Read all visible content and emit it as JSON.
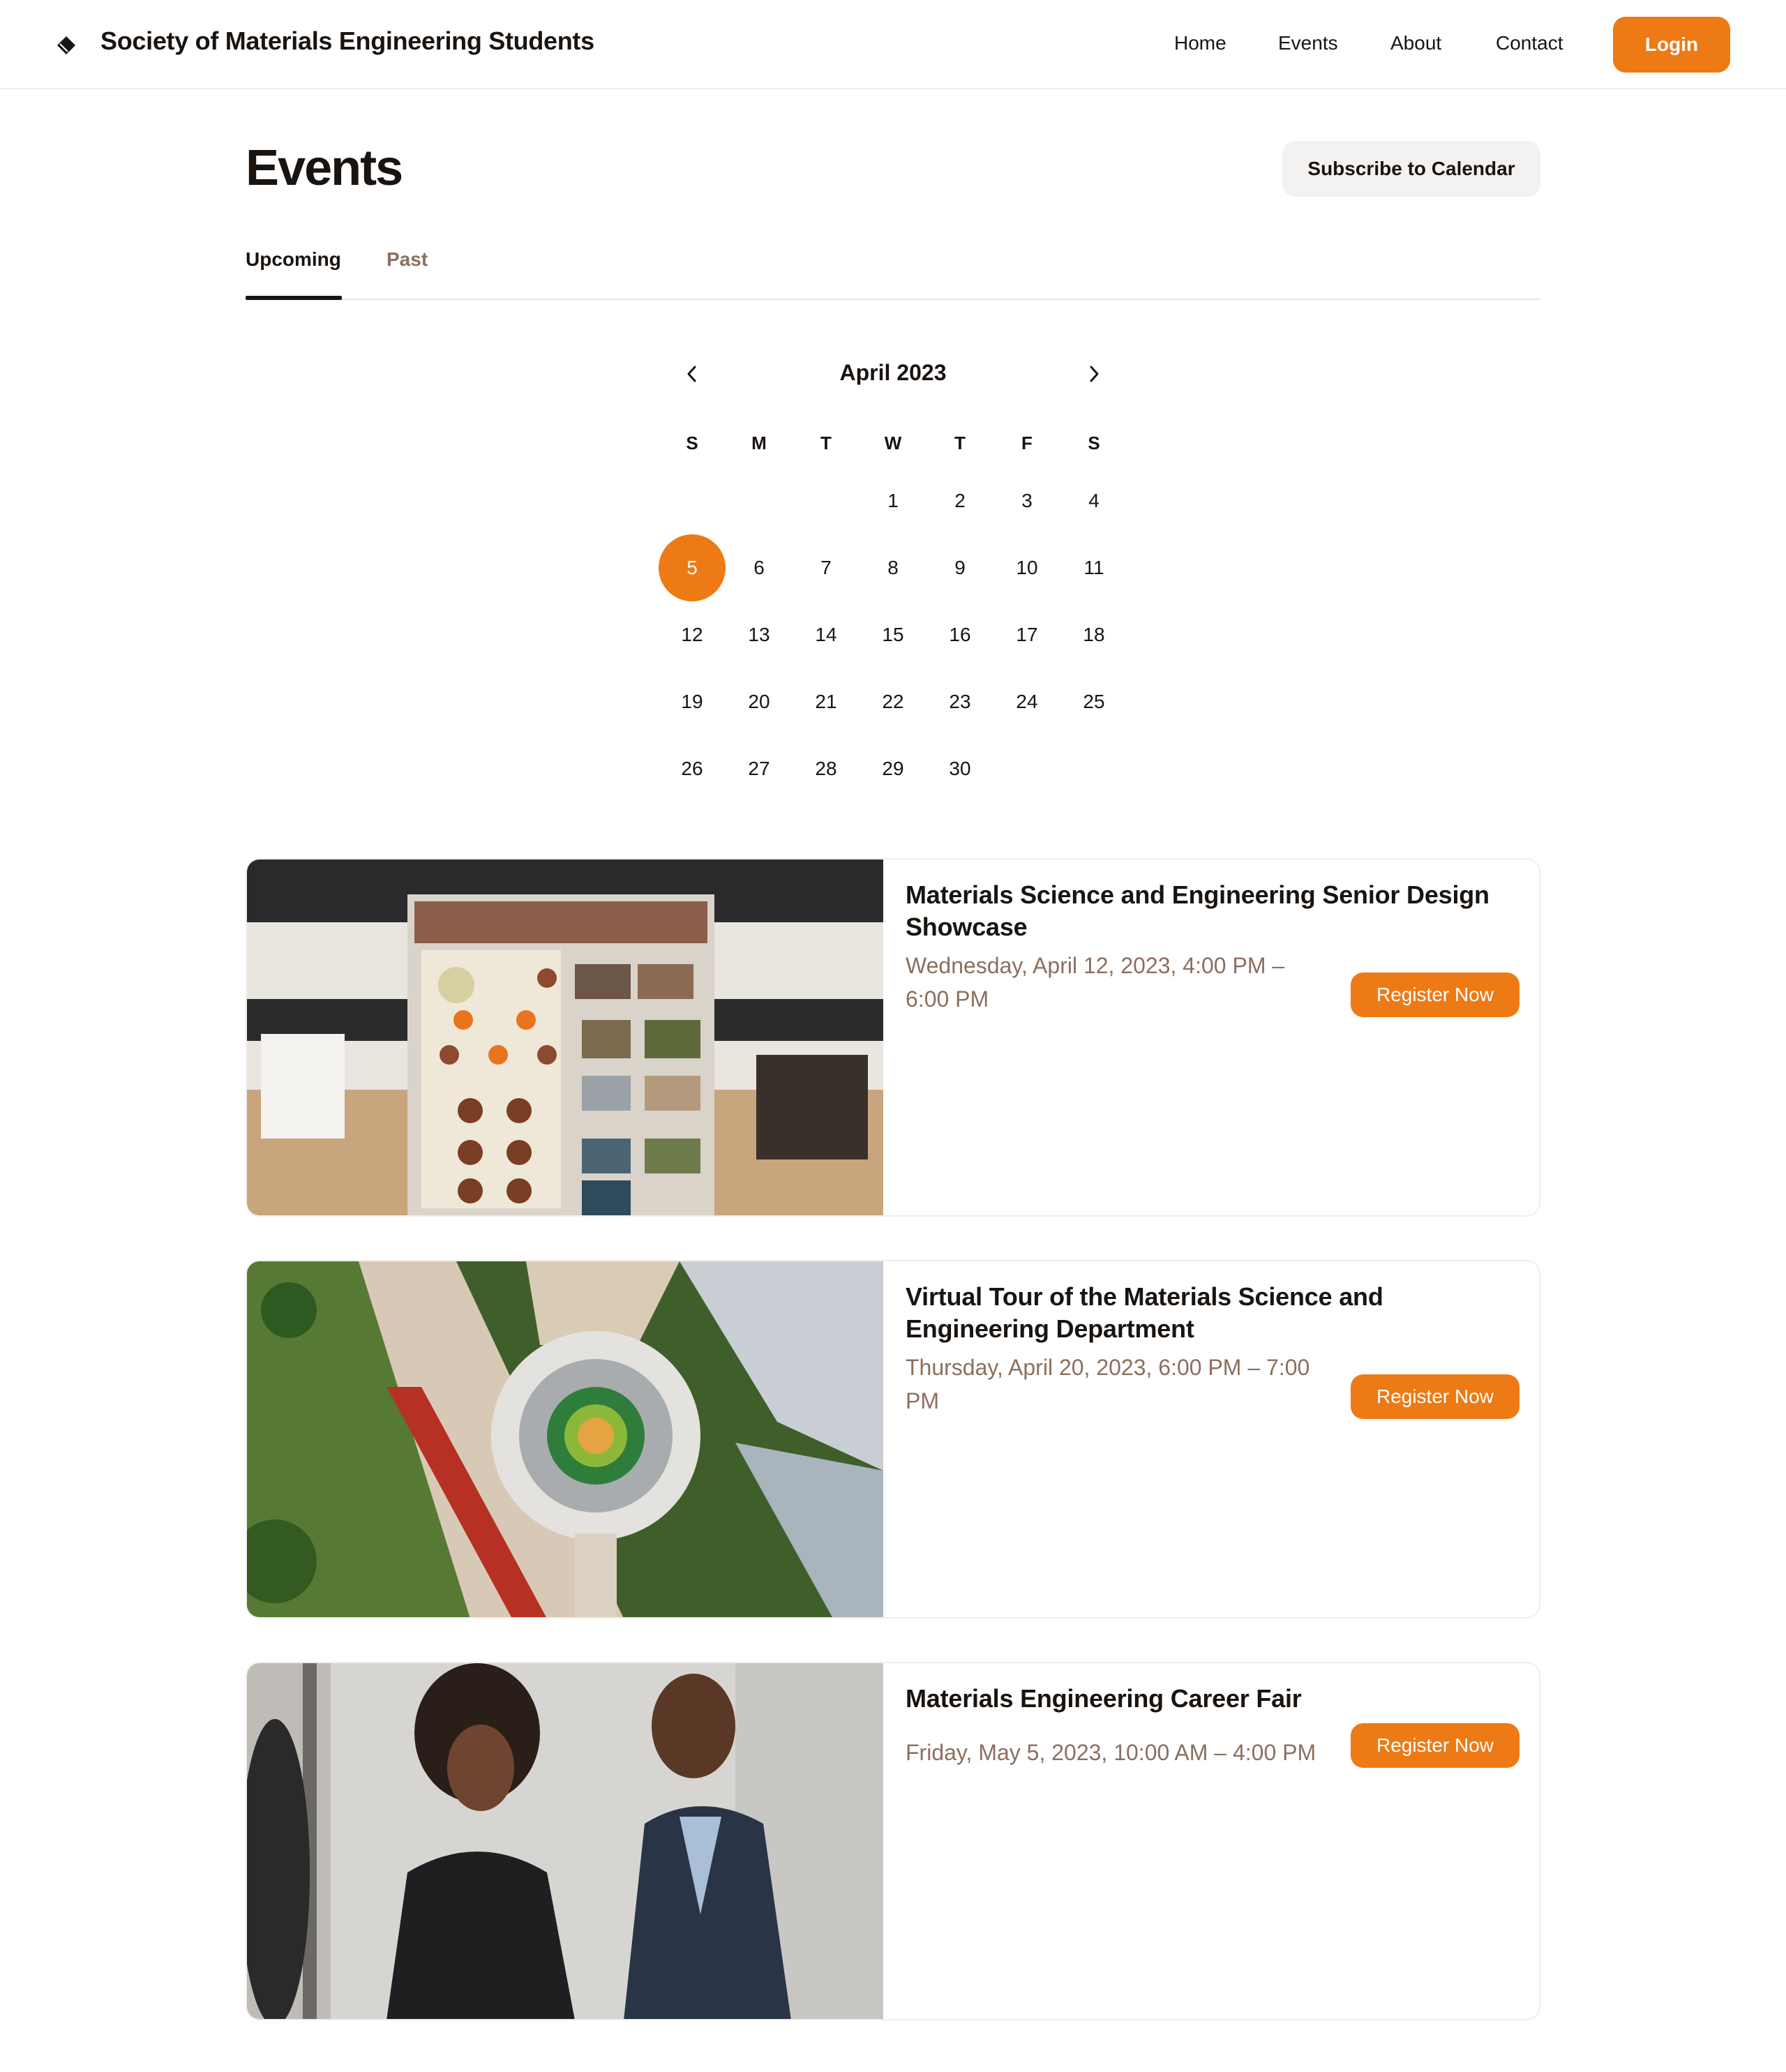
{
  "header": {
    "brand": "Society of Materials Engineering Students",
    "logo_icon": "diamond-logo-icon",
    "nav": [
      {
        "label": "Home"
      },
      {
        "label": "Events"
      },
      {
        "label": "About"
      },
      {
        "label": "Contact"
      }
    ],
    "login_label": "Login"
  },
  "page": {
    "title": "Events",
    "subscribe_label": "Subscribe to Calendar"
  },
  "tabs": [
    {
      "label": "Upcoming",
      "active": true
    },
    {
      "label": "Past",
      "active": false
    }
  ],
  "calendar": {
    "month_label": "April 2023",
    "prev_icon": "chevron-left-icon",
    "next_icon": "chevron-right-icon",
    "weekdays": [
      "S",
      "M",
      "T",
      "W",
      "T",
      "F",
      "S"
    ],
    "weeks": [
      [
        "",
        "",
        "",
        "1",
        "2",
        "3",
        "4"
      ],
      [
        "5",
        "6",
        "7",
        "8",
        "9",
        "10",
        "11"
      ],
      [
        "12",
        "13",
        "14",
        "15",
        "16",
        "17",
        "18"
      ],
      [
        "19",
        "20",
        "21",
        "22",
        "23",
        "24",
        "25"
      ],
      [
        "26",
        "27",
        "28",
        "29",
        "30",
        "",
        ""
      ]
    ],
    "selected_day": "5"
  },
  "events": [
    {
      "title": "Materials Science and Engineering Senior Design Showcase",
      "date": "Wednesday, April 12, 2023, 4:00 PM – 6:00 PM",
      "register_label": "Register Now"
    },
    {
      "title": "Virtual Tour of the Materials Science and Engineering Department",
      "date": "Thursday, April 20, 2023, 6:00 PM – 7:00 PM",
      "register_label": "Register Now"
    },
    {
      "title": "Materials Engineering Career Fair",
      "date": "Friday, May 5, 2023, 10:00 AM – 4:00 PM",
      "register_label": "Register Now"
    }
  ],
  "colors": {
    "accent": "#ee7a15",
    "muted_text": "#8b6f5e",
    "text": "#1a1410",
    "secondary_button": "#f3f2f1"
  }
}
